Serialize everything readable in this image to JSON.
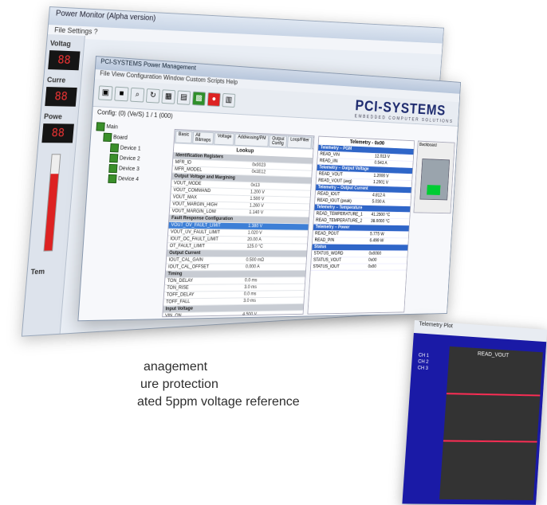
{
  "back_window": {
    "title": "Power Monitor (Alpha version)",
    "menu": "File  Settings  ?",
    "voltage_label": "Voltag",
    "current_label": "Curre",
    "power_label": "Powe",
    "temp_label": "Tem"
  },
  "app": {
    "title": "PCI-SYSTEMS Power Management",
    "menu": "File  View  Configuration  Window  Custom Scripts  Help",
    "logo": "PCI-SYSTEMS",
    "logo_sub": "EMBEDDED COMPUTER SOLUTIONS",
    "config_line": "Config: (0) (Ve/S)  1 / 1 (000)",
    "tree": [
      "Main",
      "Board",
      "Device 1",
      "Device 2",
      "Device 3",
      "Device 4"
    ],
    "grid": {
      "tabs": [
        "Basic",
        "All Bitmaps",
        "Voltage",
        "Addressing/PM",
        "Output Config",
        "Loop/Filter",
        "PWM Configuration",
        "RGB"
      ],
      "lookup_label": "Lookup",
      "rows": [
        {
          "n": "Identification Registers",
          "v": "",
          "type": "sec"
        },
        {
          "n": "MFR_ID",
          "v": "0x0023"
        },
        {
          "n": "MFR_MODEL",
          "v": "0x1E12"
        },
        {
          "n": "Output Voltage and Margining",
          "v": "",
          "type": "sec"
        },
        {
          "n": "VOUT_MODE",
          "v": "0x13"
        },
        {
          "n": "VOUT_COMMAND",
          "v": "1.200 V"
        },
        {
          "n": "VOUT_MAX",
          "v": "1.500 V"
        },
        {
          "n": "VOUT_MARGIN_HIGH",
          "v": "1.260 V"
        },
        {
          "n": "VOUT_MARGIN_LOW",
          "v": "1.140 V"
        },
        {
          "n": "Fault Response Configuration",
          "v": "",
          "type": "sec"
        },
        {
          "n": "VOUT_OV_FAULT_LIMIT",
          "v": "1.380 V",
          "type": "sel"
        },
        {
          "n": "VOUT_UV_FAULT_LIMIT",
          "v": "1.020 V"
        },
        {
          "n": "IOUT_OC_FAULT_LIMIT",
          "v": "20.00 A"
        },
        {
          "n": "OT_FAULT_LIMIT",
          "v": "125.0 °C"
        },
        {
          "n": "Output Current",
          "v": "",
          "type": "sec"
        },
        {
          "n": "IOUT_CAL_GAIN",
          "v": "0.500 mΩ"
        },
        {
          "n": "IOUT_CAL_OFFSET",
          "v": "0.000 A"
        },
        {
          "n": "Timing",
          "v": "",
          "type": "sec"
        },
        {
          "n": "TON_DELAY",
          "v": "0.0 ms"
        },
        {
          "n": "TON_RISE",
          "v": "3.0 ms"
        },
        {
          "n": "TOFF_DELAY",
          "v": "0.0 ms"
        },
        {
          "n": "TOFF_FALL",
          "v": "3.0 ms"
        },
        {
          "n": "Input Voltage",
          "v": "",
          "type": "sec"
        },
        {
          "n": "VIN_ON",
          "v": "4.500 V"
        },
        {
          "n": "VIN_OFF",
          "v": "4.250 V"
        }
      ]
    },
    "telemetry": {
      "title": "Telemetry - 0x00",
      "rows": [
        {
          "n": "Telemetry – PGM",
          "v": "",
          "type": "sec"
        },
        {
          "n": "READ_VIN",
          "v": "12.013 V"
        },
        {
          "n": "READ_IIN",
          "v": "0.541 A"
        },
        {
          "n": "Telemetry – Output Voltage",
          "v": "",
          "type": "sec"
        },
        {
          "n": "READ_VOUT",
          "v": "1.2000 V"
        },
        {
          "n": "READ_VOUT (avg)",
          "v": "1.2001 V"
        },
        {
          "n": "Telemetry – Output Current",
          "v": "",
          "type": "sec"
        },
        {
          "n": "READ_IOUT",
          "v": "4.812 A"
        },
        {
          "n": "READ_IOUT (peak)",
          "v": "5.030 A"
        },
        {
          "n": "Telemetry – Temperature",
          "v": "",
          "type": "sec"
        },
        {
          "n": "READ_TEMPERATURE_1",
          "v": "41.2500 °C"
        },
        {
          "n": "READ_TEMPERATURE_2",
          "v": "38.0000 °C"
        },
        {
          "n": "Telemetry – Power",
          "v": "",
          "type": "sec"
        },
        {
          "n": "READ_POUT",
          "v": "5.775 W"
        },
        {
          "n": "READ_PIN",
          "v": "6.499 W"
        },
        {
          "n": "Status",
          "v": "",
          "type": "sec"
        },
        {
          "n": "STATUS_WORD",
          "v": "0x0000"
        },
        {
          "n": "STATUS_VOUT",
          "v": "0x00"
        },
        {
          "n": "STATUS_IOUT",
          "v": "0x00"
        }
      ]
    },
    "board_label": "Backboard"
  },
  "plot": {
    "head": "Telemetry Plot",
    "title": "READ_VOUT",
    "legend": [
      "CH 1",
      "CH 2",
      "CH 3"
    ]
  },
  "bullets": [
    "anagement",
    "ure protection",
    "ated 5ppm voltage reference"
  ]
}
